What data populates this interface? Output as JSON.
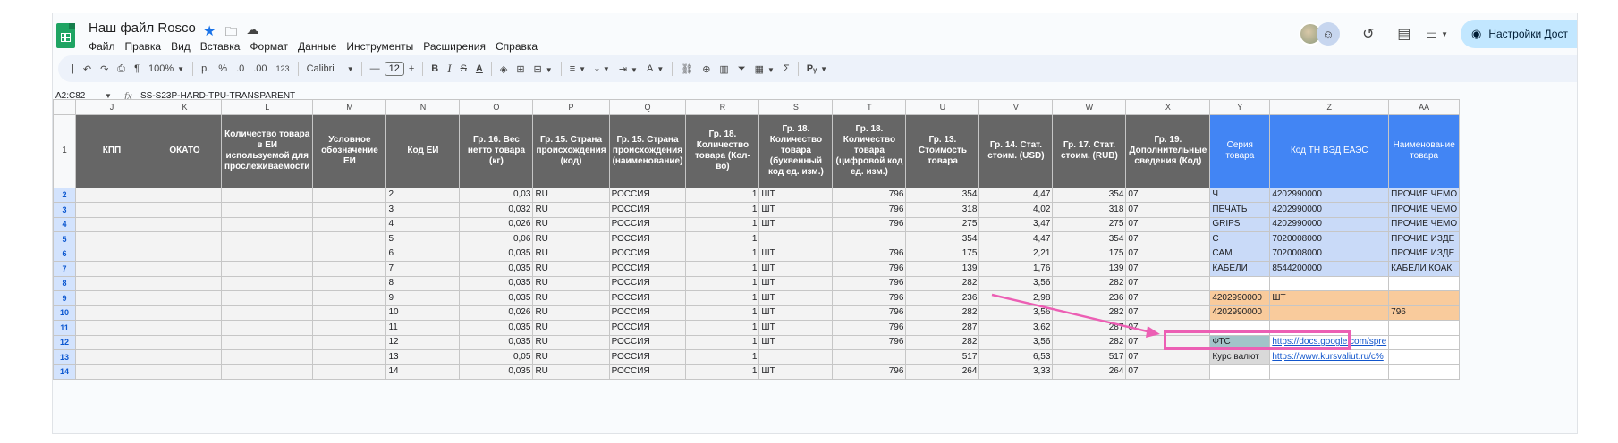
{
  "app": {
    "doc_title": "Наш файл Rosco",
    "menu": [
      "Файл",
      "Правка",
      "Вид",
      "Вставка",
      "Формат",
      "Данные",
      "Инструменты",
      "Расширения",
      "Справка"
    ],
    "settings_label": "Настройки Дост"
  },
  "toolbar": {
    "zoom": "100%",
    "currency": "р.",
    "percent": "%",
    "dec_less": ".0",
    "dec_more": ".00",
    "number_format": "123",
    "font": "Calibri",
    "font_size": "12",
    "sum": "Σ"
  },
  "formula_bar": {
    "name_box": "A2:C82",
    "fx": "fx",
    "value": "SS-S23P-HARD-TPU-TRANSPARENT"
  },
  "columns": [
    "J",
    "K",
    "L",
    "M",
    "N",
    "O",
    "P",
    "Q",
    "R",
    "S",
    "T",
    "U",
    "V",
    "W",
    "X",
    "Y",
    "Z",
    "AA"
  ],
  "header_row": {
    "row_number": "1",
    "cells": [
      "КПП",
      "ОКАТО",
      "Количество товара в ЕИ используемой для прослеживаемости",
      "Условное обозначение ЕИ",
      "Код ЕИ",
      "Гр. 16. Вес нетто товара (кг)",
      "Гр. 15. Страна происхождения (код)",
      "Гр. 15. Страна происхождения (наименование)",
      "Гр. 18. Количество товара (Кол-во)",
      "Гр. 18. Количество товара (буквенный код ед. изм.)",
      "Гр. 18. Количество товара (цифровой код ед. изм.)",
      "Гр. 13. Стоимость товара",
      "Гр. 14. Стат. стоим. (USD)",
      "Гр. 17. Стат. стоим. (RUB)",
      "Гр. 19. Дополнительные сведения (Код)",
      "Серия товара",
      "Код ТН ВЭД ЕАЭС",
      "Наименование товара"
    ]
  },
  "rows": [
    {
      "n": "2",
      "o": "0,03",
      "p": "RU",
      "q": "РОССИЯ",
      "r": "1",
      "s": "ШТ",
      "t": "796",
      "u": "354",
      "v": "4,47",
      "w": "354",
      "x": "07",
      "y": "Ч",
      "z": "4202990000",
      "aa": "ПРОЧИЕ ЧЕМО"
    },
    {
      "n": "3",
      "o": "0,032",
      "p": "RU",
      "q": "РОССИЯ",
      "r": "1",
      "s": "ШТ",
      "t": "796",
      "u": "318",
      "v": "4,02",
      "w": "318",
      "x": "07",
      "y": "ПЕЧАТЬ",
      "z": "4202990000",
      "aa": "ПРОЧИЕ ЧЕМО"
    },
    {
      "n": "4",
      "o": "0,026",
      "p": "RU",
      "q": "РОССИЯ",
      "r": "1",
      "s": "ШТ",
      "t": "796",
      "u": "275",
      "v": "3,47",
      "w": "275",
      "x": "07",
      "y": "GRIPS",
      "z": "4202990000",
      "aa": "ПРОЧИЕ ЧЕМО"
    },
    {
      "n": "5",
      "o": "0,06",
      "p": "RU",
      "q": "РОССИЯ",
      "r": "1",
      "s": "",
      "t": "",
      "u": "354",
      "v": "4,47",
      "w": "354",
      "x": "07",
      "y": "С",
      "z": "7020008000",
      "aa": "ПРОЧИЕ ИЗДЕ"
    },
    {
      "n": "6",
      "o": "0,035",
      "p": "RU",
      "q": "РОССИЯ",
      "r": "1",
      "s": "ШТ",
      "t": "796",
      "u": "175",
      "v": "2,21",
      "w": "175",
      "x": "07",
      "y": "CAM",
      "z": "7020008000",
      "aa": "ПРОЧИЕ ИЗДЕ"
    },
    {
      "n": "7",
      "o": "0,035",
      "p": "RU",
      "q": "РОССИЯ",
      "r": "1",
      "s": "ШТ",
      "t": "796",
      "u": "139",
      "v": "1,76",
      "w": "139",
      "x": "07",
      "y": "КАБЕЛИ",
      "z": "8544200000",
      "aa": "КАБЕЛИ КОАК"
    },
    {
      "n": "8",
      "o": "0,035",
      "p": "RU",
      "q": "РОССИЯ",
      "r": "1",
      "s": "ШТ",
      "t": "796",
      "u": "282",
      "v": "3,56",
      "w": "282",
      "x": "07",
      "y": "",
      "z": "",
      "aa": ""
    },
    {
      "n": "9",
      "o": "0,035",
      "p": "RU",
      "q": "РОССИЯ",
      "r": "1",
      "s": "ШТ",
      "t": "796",
      "u": "236",
      "v": "2,98",
      "w": "236",
      "x": "07",
      "y": "4202990000",
      "z": "ШТ",
      "aa": ""
    },
    {
      "n": "10",
      "o": "0,026",
      "p": "RU",
      "q": "РОССИЯ",
      "r": "1",
      "s": "ШТ",
      "t": "796",
      "u": "282",
      "v": "3,56",
      "w": "282",
      "x": "07",
      "y": "4202990000",
      "z": "",
      "aa": "796"
    },
    {
      "n": "11",
      "o": "0,035",
      "p": "RU",
      "q": "РОССИЯ",
      "r": "1",
      "s": "ШТ",
      "t": "796",
      "u": "287",
      "v": "3,62",
      "w": "287",
      "x": "07",
      "y": "",
      "z": "",
      "aa": ""
    },
    {
      "n": "12",
      "o": "0,035",
      "p": "RU",
      "q": "РОССИЯ",
      "r": "1",
      "s": "ШТ",
      "t": "796",
      "u": "282",
      "v": "3,56",
      "w": "282",
      "x": "07",
      "y": "ФТС",
      "z": "https://docs.google.com/spre",
      "aa": ""
    },
    {
      "n": "13",
      "o": "0,05",
      "p": "RU",
      "q": "РОССИЯ",
      "r": "1",
      "s": "",
      "t": "",
      "u": "517",
      "v": "6,53",
      "w": "517",
      "x": "07",
      "y": "Курс валют",
      "z": "https://www.kursvaliut.ru/с%",
      "aa": ""
    },
    {
      "n": "14",
      "o": "0,035",
      "p": "RU",
      "q": "РОССИЯ",
      "r": "1",
      "s": "ШТ",
      "t": "796",
      "u": "264",
      "v": "3,33",
      "w": "264",
      "x": "07",
      "y": "",
      "z": "",
      "aa": ""
    }
  ],
  "accent_colors": {
    "pink": "#ec5fb4",
    "blue_header": "#4285f4",
    "orange_cells": "#f9cb9c"
  }
}
